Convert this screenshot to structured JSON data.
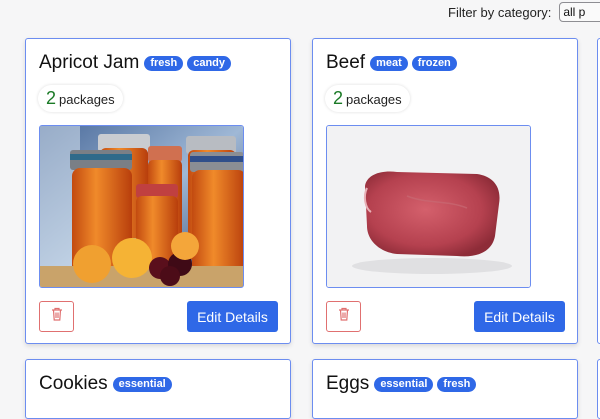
{
  "filter": {
    "label": "Filter by category:",
    "selected": "all p"
  },
  "cards": [
    {
      "name": "Apricot Jam",
      "tags": [
        "fresh",
        "candy"
      ],
      "count": "2",
      "unit": "packages",
      "edit_label": "Edit Details",
      "image": "apricot-jam-jars"
    },
    {
      "name": "Beef",
      "tags": [
        "meat",
        "frozen"
      ],
      "count": "2",
      "unit": "packages",
      "edit_label": "Edit Details",
      "image": "raw-beef"
    },
    {
      "name": "Cookies",
      "tags": [
        "essential"
      ]
    },
    {
      "name": "Eggs",
      "tags": [
        "essential",
        "fresh"
      ]
    }
  ],
  "colors": {
    "accent": "#2f68e7",
    "card_border": "#6c8df0",
    "count_green": "#1a7a26",
    "delete_red": "#e07070"
  }
}
